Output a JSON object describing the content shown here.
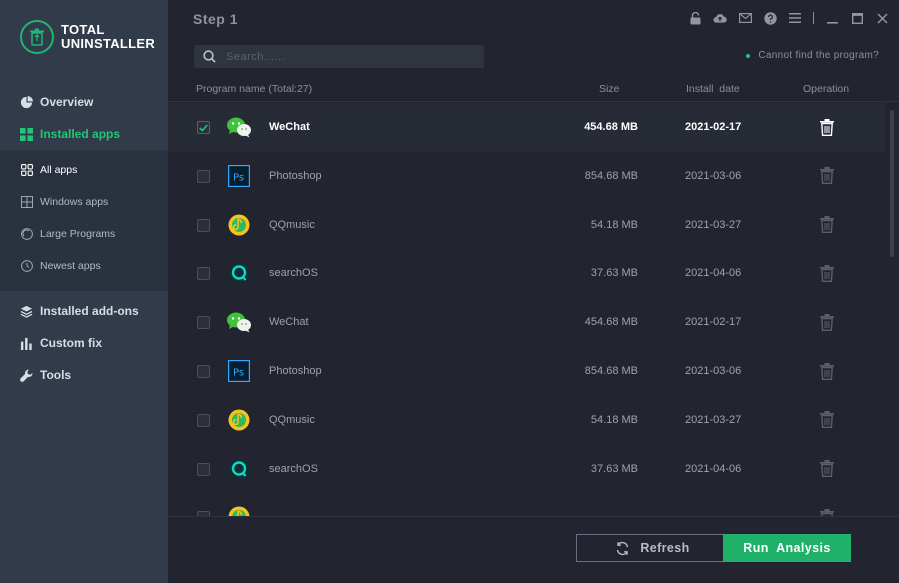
{
  "app": {
    "logo_line1": "TOTAL",
    "logo_line2": "UNINSTALLER"
  },
  "sidebar": {
    "items": [
      {
        "label": "Overview",
        "icon": "pie-chart-icon"
      },
      {
        "label": "Installed apps",
        "icon": "apps-grid-icon",
        "active": true
      },
      {
        "label": "Installed add-ons",
        "icon": "layers-icon"
      },
      {
        "label": "Custom fix",
        "icon": "bar-chart-icon"
      },
      {
        "label": "Tools",
        "icon": "wrench-icon"
      }
    ],
    "subitems": [
      {
        "label": "All apps",
        "icon": "grid-icon",
        "active": true
      },
      {
        "label": "Windows apps",
        "icon": "windows-icon"
      },
      {
        "label": "Large Programs",
        "icon": "disc-icon"
      },
      {
        "label": "Newest apps",
        "icon": "clock-icon"
      }
    ]
  },
  "header": {
    "title": "Step 1",
    "search_placeholder": "Search......",
    "cannot_find": "Cannot find the program?"
  },
  "table": {
    "columns": {
      "name": "Program name (Total:27)",
      "size": "Size",
      "date": "Install  date",
      "operation": "Operation"
    },
    "rows": [
      {
        "name": "WeChat",
        "size": "454.68 MB",
        "date": "2021-02-17",
        "icon": "wechat-icon",
        "checked": true,
        "selected": true
      },
      {
        "name": "Photoshop",
        "size": "854.68 MB",
        "date": "2021-03-06",
        "icon": "photoshop-icon",
        "checked": false
      },
      {
        "name": "QQmusic",
        "size": "54.18 MB",
        "date": "2021-03-27",
        "icon": "qqmusic-icon",
        "checked": false
      },
      {
        "name": "searchOS",
        "size": "37.63 MB",
        "date": "2021-04-06",
        "icon": "searchos-icon",
        "checked": false
      },
      {
        "name": "WeChat",
        "size": "454.68 MB",
        "date": "2021-02-17",
        "icon": "wechat-icon",
        "checked": false
      },
      {
        "name": "Photoshop",
        "size": "854.68 MB",
        "date": "2021-03-06",
        "icon": "photoshop-icon",
        "checked": false
      },
      {
        "name": "QQmusic",
        "size": "54.18 MB",
        "date": "2021-03-27",
        "icon": "qqmusic-icon",
        "checked": false
      },
      {
        "name": "searchOS",
        "size": "37.63 MB",
        "date": "2021-04-06",
        "icon": "searchos-icon",
        "checked": false
      },
      {
        "name": "",
        "size": "",
        "date": "",
        "icon": "qqmusic-icon",
        "checked": false
      }
    ]
  },
  "footer": {
    "refresh_label": "Refresh",
    "run_label": "Run  Analysis"
  },
  "colors": {
    "accent": "#1fb06a",
    "sidebar_bg": "#313b4a",
    "main_bg": "#22252f"
  }
}
